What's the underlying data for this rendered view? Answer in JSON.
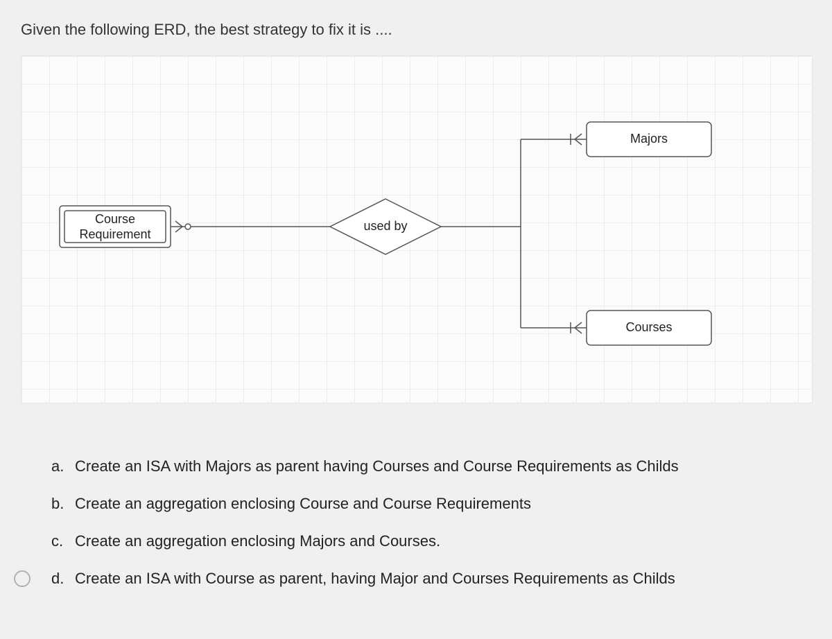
{
  "question": "Given the following ERD, the best strategy to fix it is ....",
  "diagram": {
    "entity_weak": {
      "line1": "Course",
      "line2": "Requirement"
    },
    "relationship": "used by",
    "entity_top": "Majors",
    "entity_bottom": "Courses"
  },
  "answers": {
    "a": {
      "letter": "a.",
      "text": "Create an ISA with Majors as parent having Courses and Course Requirements as Childs",
      "radio_visible": false
    },
    "b": {
      "letter": "b.",
      "text": "Create an aggregation enclosing Course and Course Requirements",
      "radio_visible": false
    },
    "c": {
      "letter": "c.",
      "text": "Create an aggregation enclosing Majors and Courses.",
      "radio_visible": false
    },
    "d": {
      "letter": "d.",
      "text": "Create an ISA with Course as parent, having Major and Courses Requirements as Childs",
      "radio_visible": true
    }
  }
}
